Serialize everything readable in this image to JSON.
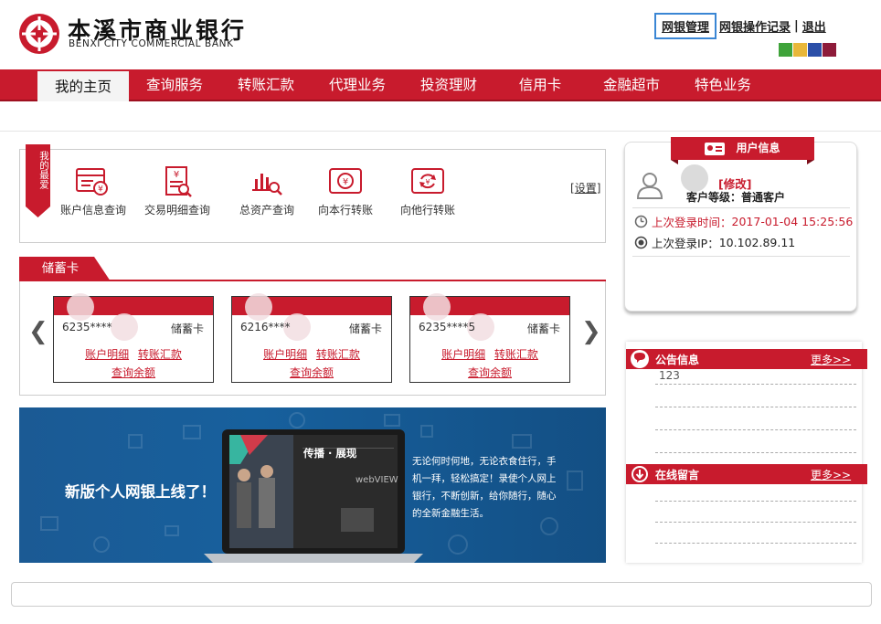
{
  "header": {
    "bank_name_cn": "本溪市商业银行",
    "bank_name_en": "BENXI CITY COMMERCIAL BANK",
    "links": {
      "ebank_manage": "网银管理",
      "ops_record": "网银操作记录",
      "separator": "|",
      "logout": "退出"
    },
    "theme_swatches": [
      "#3fa33a",
      "#e8b73a",
      "#2b4fa8",
      "#8e1b3a"
    ]
  },
  "nav": {
    "tabs": [
      {
        "label": "我的主页",
        "active": true
      },
      {
        "label": "查询服务",
        "active": false
      },
      {
        "label": "转账汇款",
        "active": false
      },
      {
        "label": "代理业务",
        "active": false
      },
      {
        "label": "投资理财",
        "active": false
      },
      {
        "label": "信用卡",
        "active": false
      },
      {
        "label": "金融超市",
        "active": false
      },
      {
        "label": "特色业务",
        "active": false
      }
    ]
  },
  "favorites": {
    "ribbon": "我的最爱",
    "setting": "设置",
    "items": [
      {
        "label": "账户信息查询",
        "icon": "account-info-icon"
      },
      {
        "label": "交易明细查询",
        "icon": "transaction-detail-icon"
      },
      {
        "label": "总资产查询",
        "icon": "total-assets-icon"
      },
      {
        "label": "向本行转账",
        "icon": "transfer-same-bank-icon"
      },
      {
        "label": "向他行转账",
        "icon": "transfer-other-bank-icon"
      }
    ]
  },
  "debit_cards": {
    "tab_label": "储蓄卡",
    "cards": [
      {
        "number": "6235****",
        "type": "储蓄卡",
        "detail_link": "账户明细",
        "transfer_link": "转账汇款",
        "balance_link": "查询余额"
      },
      {
        "number": "6216****",
        "type": "储蓄卡",
        "detail_link": "账户明细",
        "transfer_link": "转账汇款",
        "balance_link": "查询余额"
      },
      {
        "number": "6235****5",
        "type": "储蓄卡",
        "detail_link": "账户明细",
        "transfer_link": "转账汇款",
        "balance_link": "查询余额"
      }
    ],
    "prev_arrow": "❮",
    "next_arrow": "❯"
  },
  "banner": {
    "headline": "新版个人网银上线了！",
    "screen_title_1": "传播",
    "screen_title_2": "展现",
    "screen_logo": "webVIEW",
    "copy": "无论何时何地，无论衣食住行，手机一拜，轻松搞定！录使个人网上银行，不断创新，给你随行，随心的全新金融生活。"
  },
  "user_info": {
    "title": "用户信息",
    "edit": "[修改]",
    "level_label": "客户等级：",
    "level_value": "普通客户",
    "last_login_label": "上次登录时间：",
    "last_login_value": "2017-01-04 15:25:56",
    "last_ip_label": "上次登录IP：",
    "last_ip_value": "10.102.89.11"
  },
  "notices": {
    "title": "公告信息",
    "more": "更多>>",
    "items": [
      "123"
    ]
  },
  "messages": {
    "title": "在线留言",
    "more": "更多>>"
  }
}
